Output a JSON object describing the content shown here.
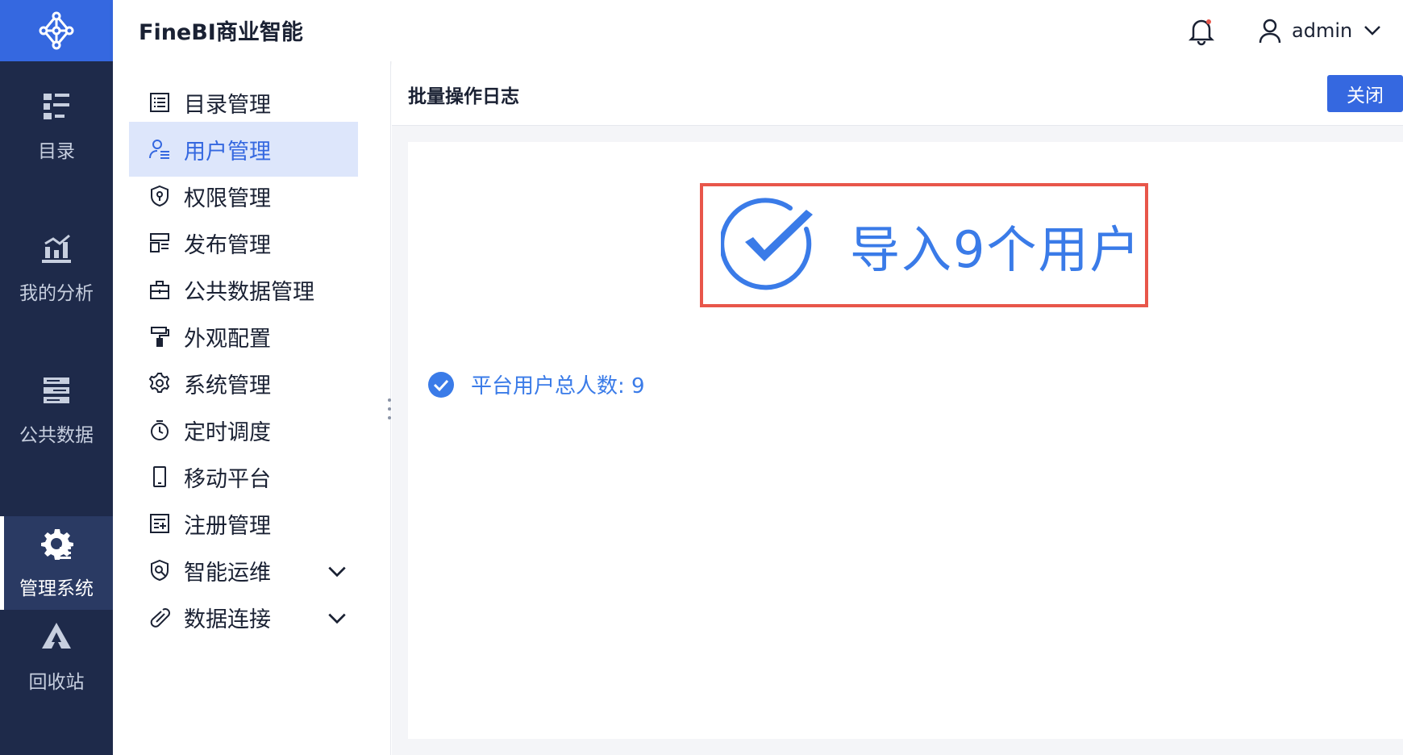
{
  "app": {
    "title": "FineBI商业智能"
  },
  "rail": {
    "items": [
      {
        "label": "目录",
        "icon": "catalog-icon"
      },
      {
        "label": "我的分析",
        "icon": "analysis-icon"
      },
      {
        "label": "公共数据",
        "icon": "public-data-icon"
      },
      {
        "label": "管理系统",
        "icon": "gear-icon",
        "active": true
      },
      {
        "label": "回收站",
        "icon": "recycle-icon"
      }
    ]
  },
  "header": {
    "username": "admin"
  },
  "subnav": {
    "items": [
      {
        "label": "目录管理",
        "icon": "list-icon"
      },
      {
        "label": "用户管理",
        "icon": "user-icon",
        "active": true
      },
      {
        "label": "权限管理",
        "icon": "shield-icon"
      },
      {
        "label": "发布管理",
        "icon": "publish-icon"
      },
      {
        "label": "公共数据管理",
        "icon": "briefcase-icon"
      },
      {
        "label": "外观配置",
        "icon": "paint-roller-icon"
      },
      {
        "label": "系统管理",
        "icon": "settings-icon"
      },
      {
        "label": "定时调度",
        "icon": "timer-icon"
      },
      {
        "label": "移动平台",
        "icon": "mobile-icon"
      },
      {
        "label": "注册管理",
        "icon": "register-icon"
      },
      {
        "label": "智能运维",
        "icon": "ops-icon",
        "expandable": true
      },
      {
        "label": "数据连接",
        "icon": "link-icon",
        "expandable": true
      }
    ]
  },
  "panel": {
    "title": "批量操作日志",
    "close_label": "关闭",
    "result_text": "导入9个用户",
    "stat_text": "平台用户总人数: 9"
  },
  "colors": {
    "accent": "#3568e0",
    "rail_bg": "#1e2a4a",
    "highlight_border": "#e8564a",
    "success_blue": "#3a7be8"
  }
}
